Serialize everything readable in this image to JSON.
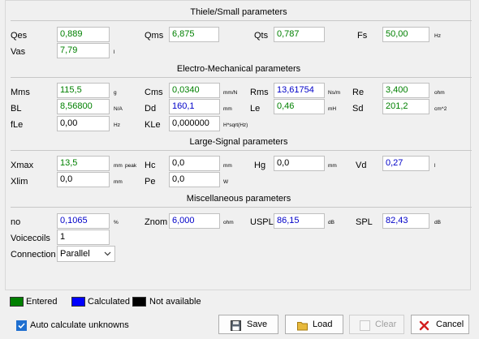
{
  "sections": {
    "thiele": "Thiele/Small parameters",
    "electro": "Electro-Mechanical parameters",
    "large_signal": "Large-Signal parameters",
    "misc": "Miscellaneous parameters"
  },
  "thiele": {
    "qes": {
      "label": "Qes",
      "value": "0,889"
    },
    "qms": {
      "label": "Qms",
      "value": "6,875"
    },
    "qts": {
      "label": "Qts",
      "value": "0,787"
    },
    "fs": {
      "label": "Fs",
      "value": "50,00",
      "unit": "Hz"
    },
    "vas": {
      "label": "Vas",
      "value": "7,79",
      "unit": "l"
    }
  },
  "electro": {
    "mms": {
      "label": "Mms",
      "value": "115,5",
      "unit": "g"
    },
    "cms": {
      "label": "Cms",
      "value": "0,0340",
      "unit": "mm/N"
    },
    "rms": {
      "label": "Rms",
      "value": "13,61754",
      "unit": "Ns/m"
    },
    "re": {
      "label": "Re",
      "value": "3,400",
      "unit": "ohm"
    },
    "bl": {
      "label": "BL",
      "value": "8,56800",
      "unit": "N/A"
    },
    "dd": {
      "label": "Dd",
      "value": "160,1",
      "unit": "mm"
    },
    "le": {
      "label": "Le",
      "value": "0,46",
      "unit": "mH"
    },
    "sd": {
      "label": "Sd",
      "value": "201,2",
      "unit": "cm^2"
    },
    "fle": {
      "label": "fLe",
      "value": "0,00",
      "unit": "Hz"
    },
    "kle": {
      "label": "KLe",
      "value": "0,000000",
      "unit": "H*sqrt(Hz)"
    }
  },
  "large_signal": {
    "xmax": {
      "label": "Xmax",
      "value": "13,5",
      "unit": "mm",
      "unit2": "peak"
    },
    "hc": {
      "label": "Hc",
      "value": "0,0",
      "unit": "mm"
    },
    "hg": {
      "label": "Hg",
      "value": "0,0",
      "unit": "mm"
    },
    "vd": {
      "label": "Vd",
      "value": "0,27",
      "unit": "l"
    },
    "xlim": {
      "label": "Xlim",
      "value": "0,0",
      "unit": "mm"
    },
    "pe": {
      "label": "Pe",
      "value": "0,0",
      "unit": "W"
    }
  },
  "misc": {
    "no": {
      "label": "no",
      "value": "0,1065",
      "unit": "%"
    },
    "znom": {
      "label": "Znom",
      "value": "6,000",
      "unit": "ohm"
    },
    "uspl": {
      "label": "USPL",
      "value": "86,15",
      "unit": "dB"
    },
    "spl": {
      "label": "SPL",
      "value": "82,43",
      "unit": "dB"
    },
    "voicecoils": {
      "label": "Voicecoils",
      "value": "1"
    },
    "connection": {
      "label": "Connection",
      "value": "Parallel"
    }
  },
  "legend": {
    "entered": "Entered",
    "calculated": "Calculated",
    "not_available": "Not available",
    "colors": {
      "entered": "#008000",
      "calculated": "#0000ff",
      "not_available": "#000000"
    }
  },
  "auto_calc": {
    "label": "Auto calculate unknowns",
    "checked": true
  },
  "buttons": {
    "save": "Save",
    "load": "Load",
    "clear": "Clear",
    "cancel": "Cancel"
  },
  "icons": {
    "save": "floppy-disk-icon",
    "load": "folder-icon",
    "clear": "eraser-icon",
    "cancel": "red-x-icon",
    "checkbox": "check-icon",
    "dropdown": "chevron-down-icon"
  }
}
